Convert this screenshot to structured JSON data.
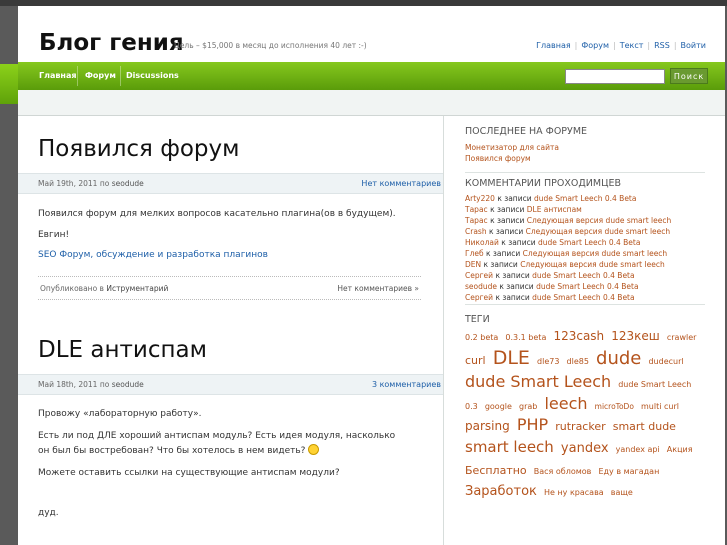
{
  "header": {
    "site_title": "Блог гения",
    "tagline": "Цель – $15,000 в месяц до исполнения 40 лет :-)",
    "links": [
      "Главная",
      "Форум",
      "Текст",
      "RSS",
      "Войти"
    ]
  },
  "nav": {
    "items": [
      "Главная",
      "Форум",
      "Discussions"
    ],
    "search_placeholder": "",
    "search_button": "Поиск"
  },
  "posts": [
    {
      "title": "Появился форум",
      "date": "Май 19th, 2011",
      "by": "по",
      "author": "seodude",
      "comments": "Нет комментариев",
      "paragraphs": [
        "Появился форум для мелких вопросов касательно плагина(ов в будущем).",
        "Евгин!"
      ],
      "link": "SEO Форум, обсуждение и разработка плагинов",
      "footer_posted": "Опубликовано в",
      "footer_category": "Иструментарий",
      "footer_comments": "Нет комментариев »"
    },
    {
      "title": "DLE антиспам",
      "date": "Май 18th, 2011",
      "by": "по",
      "author": "seodude",
      "comments": "3 комментариев",
      "paragraphs": [
        "Провожу «лабораторную работу».",
        "Есть ли под ДЛЕ хороший антиспам модуль? Есть идея модуля, насколько",
        "он был бы востребован? Что бы хотелось в нем видеть?",
        "Можете оставить ссылки на существующие антиспам модули?",
        "дуд."
      ]
    }
  ],
  "sidebar": {
    "forum_heading": "ПОСЛЕДНЕЕ НА ФОРУМЕ",
    "forum_links": [
      "Монетизатор для сайта",
      "Появился форум"
    ],
    "comments_heading": "КОММЕНТАРИИ ПРОХОДИМЦЕВ",
    "to_post": "к записи",
    "comments": [
      {
        "author": "Arty220",
        "post": "dude Smart Leech 0.4 Beta"
      },
      {
        "author": "Тарас",
        "post": "DLE антиспам"
      },
      {
        "author": "Тарас",
        "post": "Следующая версия dude smart leech"
      },
      {
        "author": "Crash",
        "post": "Следующая версия dude smart leech"
      },
      {
        "author": "Николай",
        "post": "dude Smart Leech 0.4 Beta"
      },
      {
        "author": "Глеб",
        "post": "Следующая версия dude smart leech"
      },
      {
        "author": "DEN",
        "post": "Следующая версия dude smart leech"
      },
      {
        "author": "Сергей",
        "post": "dude Smart Leech 0.4 Beta"
      },
      {
        "author": "seodude",
        "post": "dude Smart Leech 0.4 Beta"
      },
      {
        "author": "Сергей",
        "post": "dude Smart Leech 0.4 Beta"
      }
    ],
    "tags_heading": "ТЕГИ",
    "tags": [
      {
        "text": "0.2 beta",
        "size": 8
      },
      {
        "text": "0.3.1 beta",
        "size": 8
      },
      {
        "text": "123cash",
        "size": 12
      },
      {
        "text": "123кеш",
        "size": 12
      },
      {
        "text": "crawler",
        "size": 8
      },
      {
        "text": "curl",
        "size": 11
      },
      {
        "text": "DLE",
        "size": 19
      },
      {
        "text": "dle73",
        "size": 8
      },
      {
        "text": "dle85",
        "size": 8
      },
      {
        "text": "dude",
        "size": 18
      },
      {
        "text": "dudecurl",
        "size": 8
      },
      {
        "text": "dude Smart Leech",
        "size": 16
      },
      {
        "text": "dude Smart Leech 0.3",
        "size": 8
      },
      {
        "text": "google",
        "size": 8
      },
      {
        "text": "grab",
        "size": 8
      },
      {
        "text": "leech",
        "size": 16
      },
      {
        "text": "microToDo",
        "size": 7.5
      },
      {
        "text": "multi curl",
        "size": 8
      },
      {
        "text": "parsing",
        "size": 12
      },
      {
        "text": "PHP",
        "size": 16
      },
      {
        "text": "rutracker",
        "size": 11
      },
      {
        "text": "smart dude",
        "size": 11
      },
      {
        "text": "smart leech",
        "size": 15
      },
      {
        "text": "yandex",
        "size": 13
      },
      {
        "text": "yandex api",
        "size": 8
      },
      {
        "text": "Акция",
        "size": 8
      },
      {
        "text": "Бесплатно",
        "size": 11
      },
      {
        "text": "Вася обломов",
        "size": 8
      },
      {
        "text": "Еду в магадан",
        "size": 8
      },
      {
        "text": "Заработок",
        "size": 13
      },
      {
        "text": "Не ну красава",
        "size": 8
      },
      {
        "text": "ваще",
        "size": 8
      }
    ]
  }
}
